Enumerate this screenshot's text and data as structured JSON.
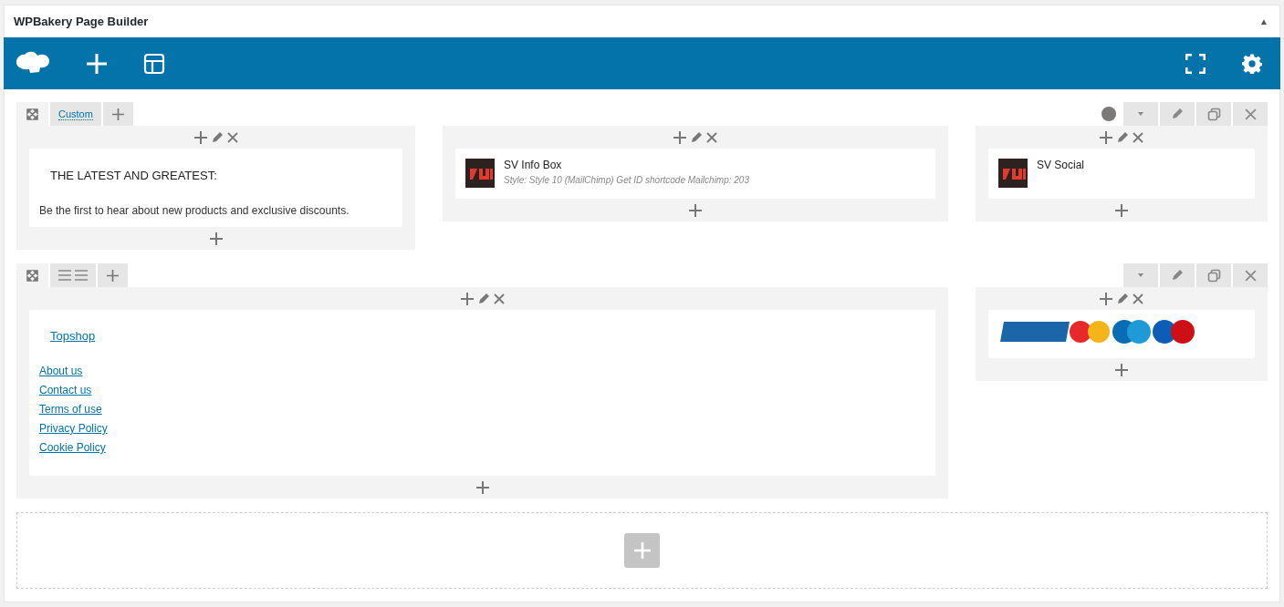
{
  "panel": {
    "title": "WPBakery Page Builder",
    "collapse_toggle": "▲"
  },
  "rows": [
    {
      "layout_tab": {
        "kind": "text",
        "label": "Custom"
      },
      "status_dot": true,
      "columns": [
        {
          "elements": [
            {
              "kind": "text",
              "heading": "THE LATEST AND GREATEST:",
              "body": "Be the first to hear about new products and exclusive discounts."
            }
          ]
        },
        {
          "elements": [
            {
              "kind": "widget",
              "title": "SV Info Box",
              "subtitle": "Style: Style 10 (MailChimp)  Get ID shortcode Mailchimp: 203"
            }
          ]
        },
        {
          "elements": [
            {
              "kind": "widget",
              "title": "SV Social"
            }
          ]
        }
      ]
    },
    {
      "layout_tab": {
        "kind": "icon"
      },
      "status_dot": false,
      "columns": [
        {
          "elements": [
            {
              "kind": "links",
              "title": "Topshop",
              "links": [
                "About us",
                "Contact us",
                "Terms of use",
                "Privacy Policy",
                "Cookie Policy"
              ]
            }
          ]
        },
        {
          "elements": [
            {
              "kind": "image"
            }
          ]
        }
      ]
    }
  ]
}
